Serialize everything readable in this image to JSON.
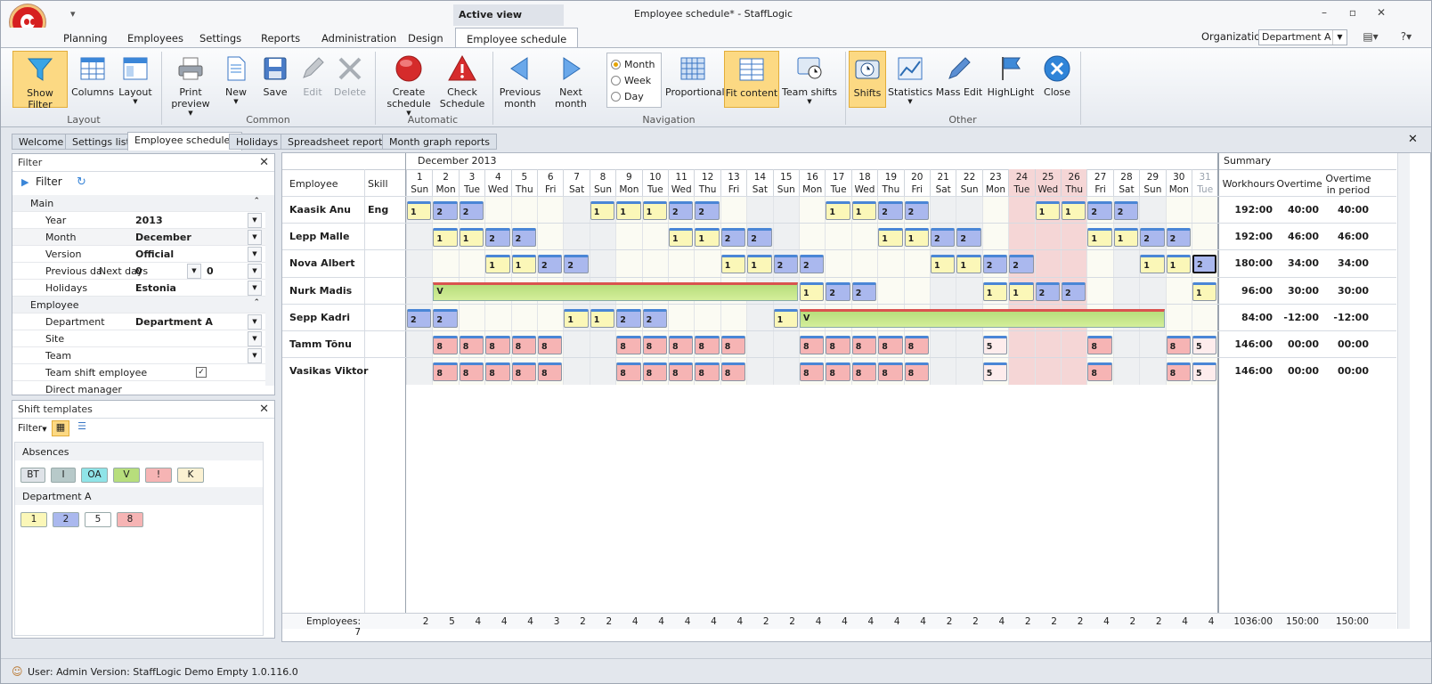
{
  "window": {
    "title": "Employee schedule* - StaffLogic",
    "active_view": "Active view"
  },
  "menu": {
    "tabs": [
      "Planning",
      "Employees",
      "Settings",
      "Reports",
      "Administration",
      "Design",
      "Employee schedule"
    ],
    "organization_label": "Organization",
    "organization_value": "Department A"
  },
  "ribbon": {
    "buttons": {
      "show_filter": "Show Filter",
      "columns": "Columns",
      "layout": "Layout",
      "print_preview": "Print preview",
      "new": "New",
      "save": "Save",
      "edit": "Edit",
      "delete": "Delete",
      "create_schedule": "Create schedule",
      "check_schedule": "Check Schedule",
      "previous_month": "Previous month",
      "next_month": "Next month",
      "proportional": "Proportional",
      "fit_content": "Fit content",
      "team_shifts": "Team shifts",
      "shifts": "Shifts",
      "statistics": "Statistics",
      "mass_edit": "Mass Edit",
      "highlight": "HighLight",
      "close": "Close"
    },
    "radios": [
      "Month",
      "Week",
      "Day"
    ],
    "groups": [
      "Layout",
      "Common",
      "Automatic",
      "Navigation",
      "Other"
    ]
  },
  "doctabs": [
    "Welcome",
    "Settings list",
    "Employee schedule*",
    "Holidays",
    "Spreadsheet reports",
    "Month graph reports"
  ],
  "filter_panel": {
    "title": "Filter",
    "filter_label": "Filter",
    "main_cat": "Main",
    "year_label": "Year",
    "year": "2013",
    "month_label": "Month",
    "month": "December",
    "version_label": "Version",
    "version": "Official",
    "prev_label": "Previous day",
    "next_label": "Next days",
    "prev_value": "0",
    "next_value": "0",
    "holidays_label": "Holidays",
    "holidays": "Estonia",
    "employee_cat": "Employee",
    "department_label": "Department",
    "department": "Department A",
    "site_label": "Site",
    "team_label": "Team",
    "team_shift_label": "Team shift employee",
    "direct_manager_label": "Direct manager"
  },
  "templates_panel": {
    "title": "Shift templates",
    "filter_label": "Filter",
    "absences_label": "Absences",
    "absences": [
      "BT",
      "I",
      "OA",
      "V",
      "!",
      "K"
    ],
    "department_label": "Department A",
    "department_shifts": [
      "1",
      "2",
      "5",
      "8"
    ]
  },
  "grid": {
    "month_label": "December 2013",
    "summary_label": "Summary",
    "col_employee": "Employee",
    "col_skill": "Skill",
    "col_workhours": "Workhours",
    "col_overtime": "Overtime",
    "col_overtime_period": "Overtime in period",
    "days": [
      {
        "d": "1",
        "w": "Sun"
      },
      {
        "d": "2",
        "w": "Mon"
      },
      {
        "d": "3",
        "w": "Tue"
      },
      {
        "d": "4",
        "w": "Wed"
      },
      {
        "d": "5",
        "w": "Thu"
      },
      {
        "d": "6",
        "w": "Fri"
      },
      {
        "d": "7",
        "w": "Sat"
      },
      {
        "d": "8",
        "w": "Sun"
      },
      {
        "d": "9",
        "w": "Mon"
      },
      {
        "d": "10",
        "w": "Tue"
      },
      {
        "d": "11",
        "w": "Wed"
      },
      {
        "d": "12",
        "w": "Thu"
      },
      {
        "d": "13",
        "w": "Fri"
      },
      {
        "d": "14",
        "w": "Sat"
      },
      {
        "d": "15",
        "w": "Sun"
      },
      {
        "d": "16",
        "w": "Mon"
      },
      {
        "d": "17",
        "w": "Tue"
      },
      {
        "d": "18",
        "w": "Wed"
      },
      {
        "d": "19",
        "w": "Thu"
      },
      {
        "d": "20",
        "w": "Fri"
      },
      {
        "d": "21",
        "w": "Sat"
      },
      {
        "d": "22",
        "w": "Sun"
      },
      {
        "d": "23",
        "w": "Mon"
      },
      {
        "d": "24",
        "w": "Tue"
      },
      {
        "d": "25",
        "w": "Wed"
      },
      {
        "d": "26",
        "w": "Thu"
      },
      {
        "d": "27",
        "w": "Fri"
      },
      {
        "d": "28",
        "w": "Sat"
      },
      {
        "d": "29",
        "w": "Sun"
      },
      {
        "d": "30",
        "w": "Mon"
      },
      {
        "d": "31",
        "w": "Tue"
      }
    ],
    "holidays_days": [
      24,
      25,
      26
    ],
    "employees": [
      {
        "name": "Kaasik  Anu",
        "skill": "Eng",
        "shifts": {
          "1": "1",
          "2": "2",
          "3": "2",
          "8": "1",
          "9": "1",
          "10": "1",
          "11": "2",
          "12": "2",
          "17": "1",
          "18": "1",
          "19": "2",
          "20": "2",
          "25": "1",
          "26": "1",
          "27": "2",
          "28": "2"
        },
        "workhours": "192:00",
        "overtime": "40:00",
        "overtime_period": "40:00"
      },
      {
        "name": "Lepp Malle",
        "skill": "",
        "shifts": {
          "2": "1",
          "3": "1",
          "4": "2",
          "5": "2",
          "11": "1",
          "12": "1",
          "13": "2",
          "14": "2",
          "19": "1",
          "20": "1",
          "21": "2",
          "22": "2",
          "27": "1",
          "28": "1",
          "29": "2",
          "30": "2"
        },
        "workhours": "192:00",
        "overtime": "46:00",
        "overtime_period": "46:00"
      },
      {
        "name": "Nova Albert",
        "skill": "",
        "shifts": {
          "4": "1",
          "5": "1",
          "6": "2",
          "7": "2",
          "13": "1",
          "14": "1",
          "15": "2",
          "16": "2",
          "21": "1",
          "22": "1",
          "23": "2",
          "24": "2",
          "29": "1",
          "30": "1",
          "31": "2"
        },
        "workhours": "180:00",
        "overtime": "34:00",
        "overtime_period": "34:00"
      },
      {
        "name": "Nurk Madis",
        "skill": "",
        "vacation": {
          "from": 2,
          "to": 15,
          "label": "V"
        },
        "shifts": {
          "16": "1",
          "17": "2",
          "18": "2",
          "23": "1",
          "24": "1",
          "25": "2",
          "26": "2",
          "31": "1"
        },
        "workhours": "96:00",
        "overtime": "30:00",
        "overtime_period": "30:00"
      },
      {
        "name": "Sepp Kadri",
        "skill": "",
        "vacation": {
          "from": 16,
          "to": 29,
          "label": "V"
        },
        "shifts": {
          "1": "2",
          "2": "2",
          "7": "1",
          "8": "1",
          "9": "2",
          "10": "2",
          "15": "1"
        },
        "workhours": "84:00",
        "overtime": "-12:00",
        "overtime_period": "-12:00"
      },
      {
        "name": "Tamm Tõnu",
        "skill": "",
        "shifts": {
          "2": "8",
          "3": "8",
          "4": "8",
          "5": "8",
          "6": "8",
          "9": "8",
          "10": "8",
          "11": "8",
          "12": "8",
          "13": "8",
          "16": "8",
          "17": "8",
          "18": "8",
          "19": "8",
          "20": "8",
          "23": "5",
          "27": "8",
          "30": "8",
          "31": "5"
        },
        "workhours": "146:00",
        "overtime": "00:00",
        "overtime_period": "00:00"
      },
      {
        "name": "Vasikas Viktor",
        "skill": "",
        "shifts": {
          "2": "8",
          "3": "8",
          "4": "8",
          "5": "8",
          "6": "8",
          "9": "8",
          "10": "8",
          "11": "8",
          "12": "8",
          "13": "8",
          "16": "8",
          "17": "8",
          "18": "8",
          "19": "8",
          "20": "8",
          "23": "5",
          "27": "8",
          "30": "8",
          "31": "5"
        },
        "workhours": "146:00",
        "overtime": "00:00",
        "overtime_period": "00:00"
      }
    ],
    "footer": {
      "employees_label": "Employees: 7",
      "day_counts": [
        "2",
        "5",
        "4",
        "4",
        "4",
        "3",
        "2",
        "2",
        "4",
        "4",
        "4",
        "4",
        "4",
        "2",
        "2",
        "4",
        "4",
        "4",
        "4",
        "4",
        "2",
        "2",
        "4",
        "2",
        "2",
        "2",
        "4",
        "2",
        "2",
        "4",
        "4"
      ],
      "workhours_total": "1036:00",
      "overtime_total": "150:00",
      "overtime_period_total": "150:00"
    }
  },
  "status": {
    "text": "User: Admin   Version: StaffLogic Demo Empty 1.0.116.0"
  },
  "colors": {
    "shift1": "#fbf7b8",
    "shift2": "#aab8ee",
    "shift8": "#f6b4b4",
    "shift5": "#fdecec",
    "vacation": "#b7de7c",
    "holiday": "#f5d6d6",
    "weekend": "#eef0f2",
    "selected": "#fcd983"
  }
}
